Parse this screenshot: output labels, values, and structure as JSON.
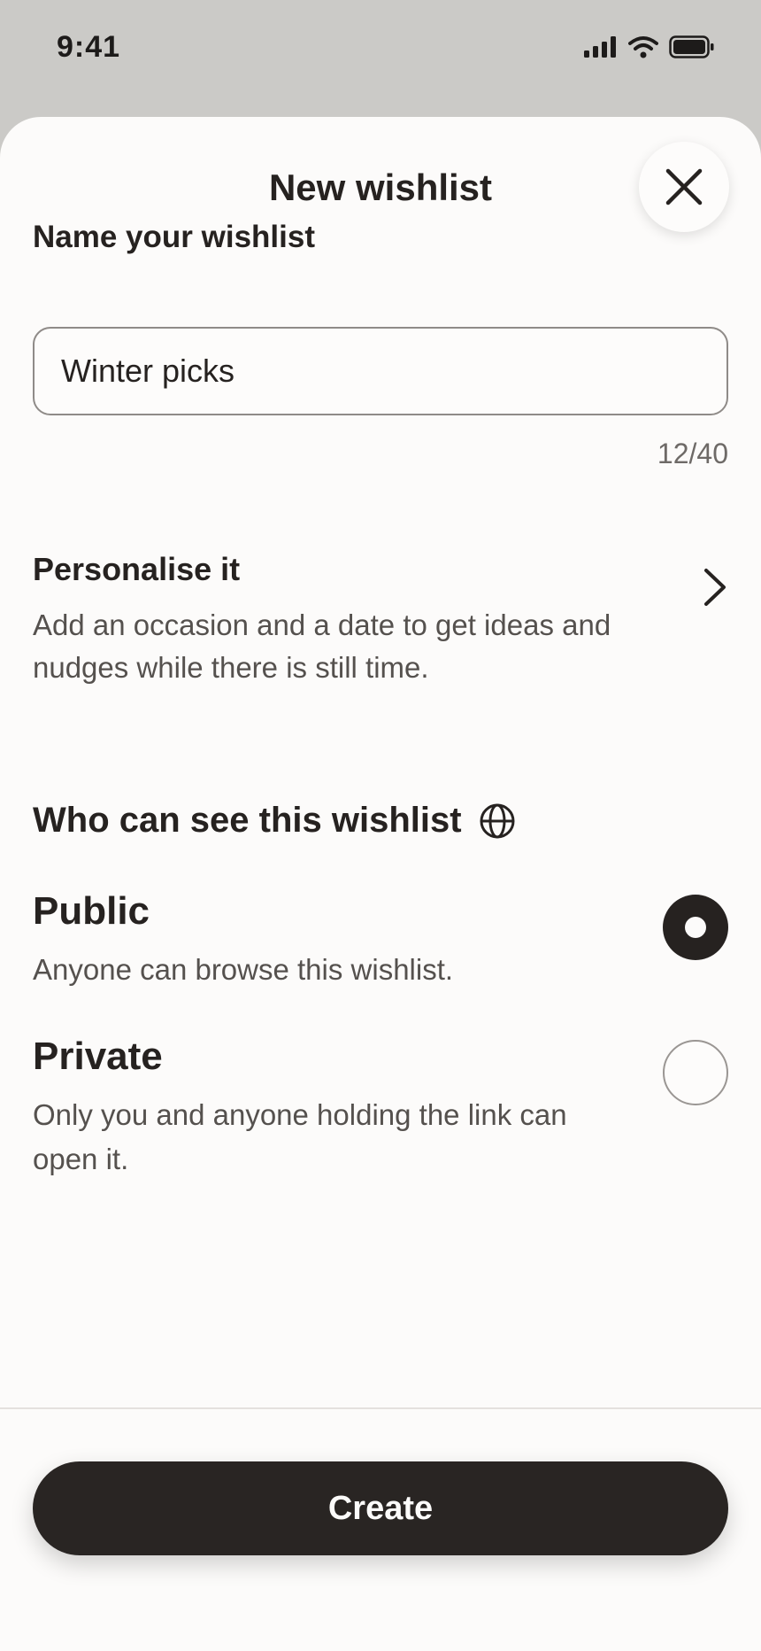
{
  "status_bar": {
    "time": "9:41",
    "icons": [
      "cellular-signal-icon",
      "wifi-icon",
      "battery-icon"
    ]
  },
  "sheet": {
    "title": "New wishlist",
    "close_icon": "close-icon"
  },
  "name_section": {
    "label": "Name your wishlist",
    "input_value": "Winter picks",
    "char_count": "12/40"
  },
  "personalise": {
    "title": "Personalise it",
    "description": "Add an occasion and a date to get ideas and nudges while there is still time.",
    "icon": "chevron-right-icon"
  },
  "visibility": {
    "heading": "Who can see this wishlist",
    "heading_icon": "globe-icon",
    "options": [
      {
        "title": "Public",
        "description": "Anyone can browse this wishlist.",
        "selected": true
      },
      {
        "title": "Private",
        "description": "Only you and anyone holding the link can open it.",
        "selected": false
      }
    ]
  },
  "footer": {
    "create_label": "Create"
  },
  "colors": {
    "backdrop": "#cbcac7",
    "sheet": "#fcfbfa",
    "text_primary": "#262220",
    "text_secondary": "#55514e",
    "button": "#292523"
  }
}
